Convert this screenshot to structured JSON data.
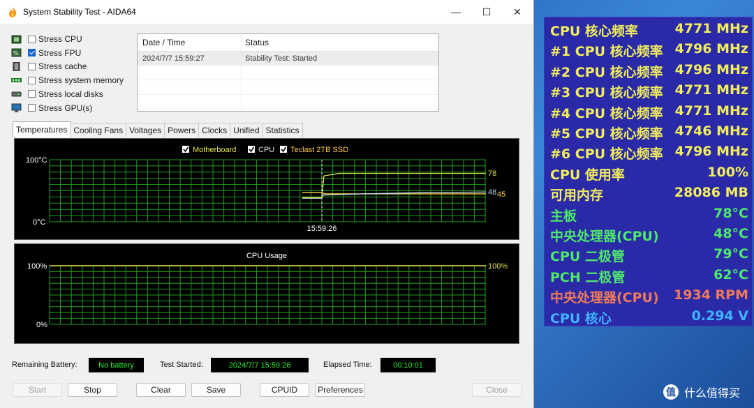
{
  "window": {
    "title": "System Stability Test - AIDA64",
    "min": "—",
    "max": "☐",
    "close": "✕"
  },
  "stress_items": [
    {
      "label": "Stress CPU",
      "checked": false,
      "icon": "cpu-chip-icon"
    },
    {
      "label": "Stress FPU",
      "checked": true,
      "icon": "fpu-icon"
    },
    {
      "label": "Stress cache",
      "checked": false,
      "icon": "cache-icon"
    },
    {
      "label": "Stress system memory",
      "checked": false,
      "icon": "memory-icon"
    },
    {
      "label": "Stress local disks",
      "checked": false,
      "icon": "disk-icon"
    },
    {
      "label": "Stress GPU(s)",
      "checked": false,
      "icon": "monitor-icon"
    }
  ],
  "log": {
    "headers": [
      "Date / Time",
      "Status"
    ],
    "rows": [
      {
        "datetime": "2024/7/7 15:59:27",
        "status": "Stability Test: Started"
      }
    ]
  },
  "tabs": [
    "Temperatures",
    "Cooling Fans",
    "Voltages",
    "Powers",
    "Clocks",
    "Unified",
    "Statistics"
  ],
  "temp_graph": {
    "legend": [
      {
        "label": "Motherboard",
        "color": "#e8e84a"
      },
      {
        "label": "CPU",
        "color": "#e6e6e6"
      },
      {
        "label": "Teclast 2TB SSD",
        "color": "#ffcf4a"
      }
    ],
    "y_top": "100°C",
    "y_bottom": "0°C",
    "marker_time": "15:59:26",
    "end_values": {
      "motherboard": "78",
      "cpu": "48",
      "ssd": "45"
    },
    "series_values": {
      "motherboard": 78,
      "cpu": 48,
      "ssd": 45,
      "before_start": 38
    }
  },
  "usage_graph": {
    "title": "CPU Usage",
    "y_top": "100%",
    "y_bottom": "0%",
    "end_value": "100%"
  },
  "status_bar": {
    "battery_label": "Remaining Battery:",
    "battery_value": "No battery",
    "started_label": "Test Started:",
    "started_value": "2024/7/7 15:59:26",
    "elapsed_label": "Elapsed Time:",
    "elapsed_value": "00:10:01"
  },
  "buttons": {
    "start": "Start",
    "stop": "Stop",
    "clear": "Clear",
    "save": "Save",
    "cpuid": "CPUID",
    "preferences": "Preferences",
    "close": "Close"
  },
  "osd": [
    {
      "key": "CPU 核心频率",
      "value": "4771 MHz",
      "color": "#f2ee5c"
    },
    {
      "key": "#1 CPU 核心频率",
      "value": "4796 MHz",
      "color": "#f2ee5c"
    },
    {
      "key": "#2 CPU 核心频率",
      "value": "4796 MHz",
      "color": "#f2ee5c"
    },
    {
      "key": "#3 CPU 核心频率",
      "value": "4771 MHz",
      "color": "#f2ee5c"
    },
    {
      "key": "#4 CPU 核心频率",
      "value": "4771 MHz",
      "color": "#f2ee5c"
    },
    {
      "key": "#5 CPU 核心频率",
      "value": "4746 MHz",
      "color": "#f2ee5c"
    },
    {
      "key": "#6 CPU 核心频率",
      "value": "4796 MHz",
      "color": "#f2ee5c"
    },
    {
      "key": "CPU 使用率",
      "value": "100%",
      "color": "#f2ee5c"
    },
    {
      "key": "可用内存",
      "value": "28086 MB",
      "color": "#f2ee5c"
    },
    {
      "key": "主板",
      "value": "78°C",
      "color": "#4ee86a"
    },
    {
      "key": "中央处理器(CPU)",
      "value": "48°C",
      "color": "#4ee86a"
    },
    {
      "key": "CPU 二极管",
      "value": "79°C",
      "color": "#4ee86a"
    },
    {
      "key": "PCH 二极管",
      "value": "62°C",
      "color": "#4ee86a"
    },
    {
      "key": "中央处理器(CPU)",
      "value": "1934 RPM",
      "color": "#ef7a5a"
    },
    {
      "key": "CPU 核心",
      "value": "0.294 V",
      "color": "#3fb6ff"
    }
  ],
  "brand": {
    "text": "什么值得买",
    "logo": "值"
  }
}
